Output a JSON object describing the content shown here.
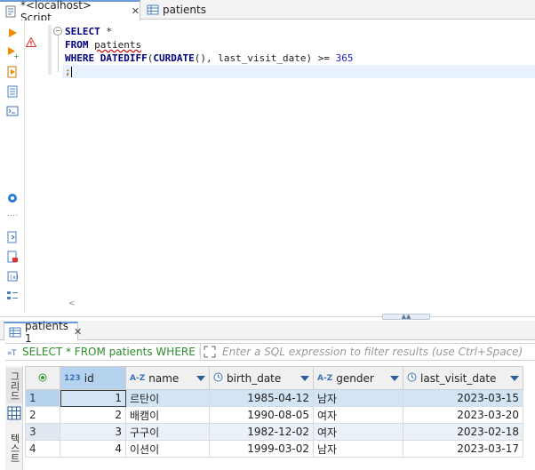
{
  "editor_tabs": [
    {
      "label": "*<localhost> Script",
      "close": "✕"
    },
    {
      "label": "patients"
    }
  ],
  "sql": {
    "line1_kw": "SELECT",
    "line1_rest": " *",
    "line2_kw": "FROM",
    "line2_table": "patients",
    "line3_kw": "WHERE",
    "line3_fn1": "DATEDIFF",
    "line3_a": "(",
    "line3_fn2": "CURDATE",
    "line3_b": "(), last_visit_date) >= ",
    "line3_num": "365",
    "line4": ";"
  },
  "results_tab": {
    "label": "patients 1",
    "close": "✕"
  },
  "filter": {
    "query_text": "SELECT * FROM patients WHERE DATEDIFF",
    "placeholder": "Enter a SQL expression to filter results (use Ctrl+Space)"
  },
  "side_tabs": {
    "grid": "그리드",
    "text": "텍스트"
  },
  "columns": [
    {
      "type": "123",
      "name": "id"
    },
    {
      "type": "A-Z",
      "name": "name"
    },
    {
      "type": "clock",
      "name": "birth_date"
    },
    {
      "type": "A-Z",
      "name": "gender"
    },
    {
      "type": "clock",
      "name": "last_visit_date"
    }
  ],
  "rows": [
    {
      "rownum": "1",
      "id": "1",
      "name": "르탄이",
      "birth_date": "1985-04-12",
      "gender": "남자",
      "last_visit_date": "2023-03-15"
    },
    {
      "rownum": "2",
      "id": "2",
      "name": "배캠이",
      "birth_date": "1990-08-05",
      "gender": "여자",
      "last_visit_date": "2023-03-20"
    },
    {
      "rownum": "3",
      "id": "3",
      "name": "구구이",
      "birth_date": "1982-12-02",
      "gender": "여자",
      "last_visit_date": "2023-02-18"
    },
    {
      "rownum": "4",
      "id": "4",
      "name": "이션이",
      "birth_date": "1999-03-02",
      "gender": "남자",
      "last_visit_date": "2023-03-17"
    }
  ],
  "colors": {
    "accent": "#6a9bd8",
    "selected_row": "#d3e4f5",
    "keyword": "#00007f",
    "filter_text": "#2d8a2d"
  }
}
